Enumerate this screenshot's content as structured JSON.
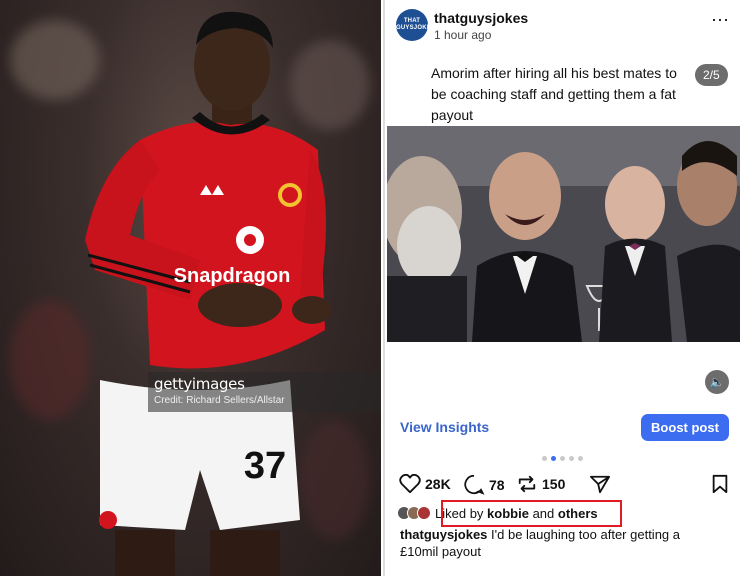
{
  "photo": {
    "brand": "gettyimages",
    "credit": "Credit: Richard Sellers/Allstar",
    "shirt_sponsor": "Snapdragon",
    "shirt_number": "37"
  },
  "post": {
    "avatar_text": "THAT GUYSJOKES",
    "username": "thatguysjokes",
    "timestamp": "1 hour ago",
    "more_icon": "⋯",
    "caption": "Amorim after hiring all his best mates to be coaching staff and getting them a fat payout",
    "slide_counter": "2/5",
    "view_insights": "View Insights",
    "boost_label": "Boost post",
    "carousel": {
      "total": 5,
      "active": 2
    },
    "actions": {
      "likes": "28K",
      "comments": "78",
      "reposts": "150"
    },
    "liked_by": {
      "prefix": "Liked by ",
      "user": "kobbie",
      "middle": " and ",
      "others": "others"
    },
    "comment": {
      "author": "thatguysjokes",
      "text": " I'd be laughing too after getting a £10mil payout"
    }
  },
  "colors": {
    "accent": "#3c6cf0",
    "link": "#3a66c9",
    "highlight_box": "#e01b24",
    "kit_red": "#d2141e"
  }
}
